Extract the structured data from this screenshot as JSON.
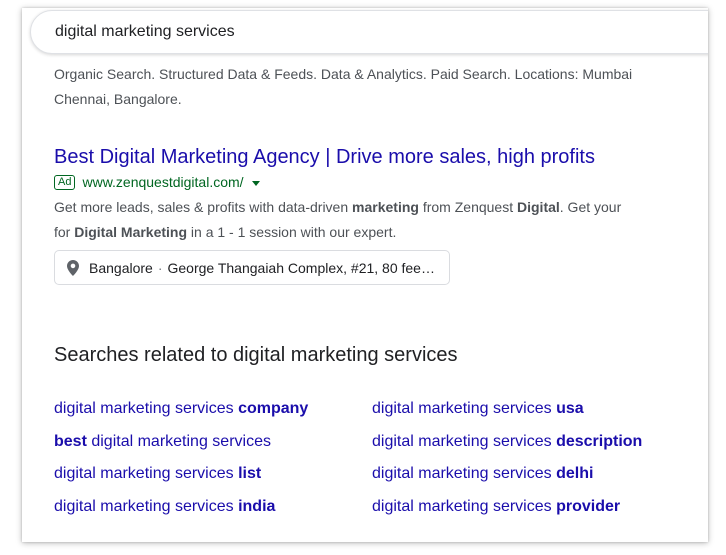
{
  "search": {
    "query": "digital marketing services"
  },
  "previous_result": {
    "snippet_line1": "Organic Search. Structured Data & Feeds. Data & Analytics. Paid Search. Locations: Mumbai",
    "snippet_line2": "Chennai, Bangalore."
  },
  "ad": {
    "title": "Best Digital Marketing Agency | Drive more sales, high profits",
    "badge": "Ad",
    "url": "www.zenquestdigital.com/",
    "desc_line1": [
      {
        "text": "Get more leads, sales & profits with data-driven ",
        "bold": false
      },
      {
        "text": "marketing",
        "bold": true
      },
      {
        "text": " from Zenquest ",
        "bold": false
      },
      {
        "text": "Digital",
        "bold": true
      },
      {
        "text": ". Get your",
        "bold": false
      }
    ],
    "desc_line2": [
      {
        "text": "for ",
        "bold": false
      },
      {
        "text": "Digital Marketing",
        "bold": true
      },
      {
        "text": " in a 1 - 1 session with our expert.",
        "bold": false
      }
    ],
    "location": {
      "city": "Bangalore",
      "address": "George Thangaiah Complex, #21, 80 fee…"
    }
  },
  "related": {
    "heading": "Searches related to digital marketing services",
    "items": [
      {
        "prefix": "digital marketing services ",
        "bold": "company",
        "suffix": ""
      },
      {
        "prefix": "digital marketing services ",
        "bold": "usa",
        "suffix": ""
      },
      {
        "prefix": "",
        "bold": "best",
        "suffix": " digital marketing services"
      },
      {
        "prefix": "digital marketing services ",
        "bold": "description",
        "suffix": ""
      },
      {
        "prefix": "digital marketing services ",
        "bold": "list",
        "suffix": ""
      },
      {
        "prefix": "digital marketing services ",
        "bold": "delhi",
        "suffix": ""
      },
      {
        "prefix": "digital marketing services ",
        "bold": "india",
        "suffix": ""
      },
      {
        "prefix": "digital marketing services ",
        "bold": "provider",
        "suffix": ""
      }
    ]
  },
  "colors": {
    "link": "#1a0dab",
    "url_green": "#006621",
    "snippet": "#4d5156"
  },
  "icons": {
    "location": "map-pin-icon",
    "url_dropdown": "caret-down-icon"
  }
}
